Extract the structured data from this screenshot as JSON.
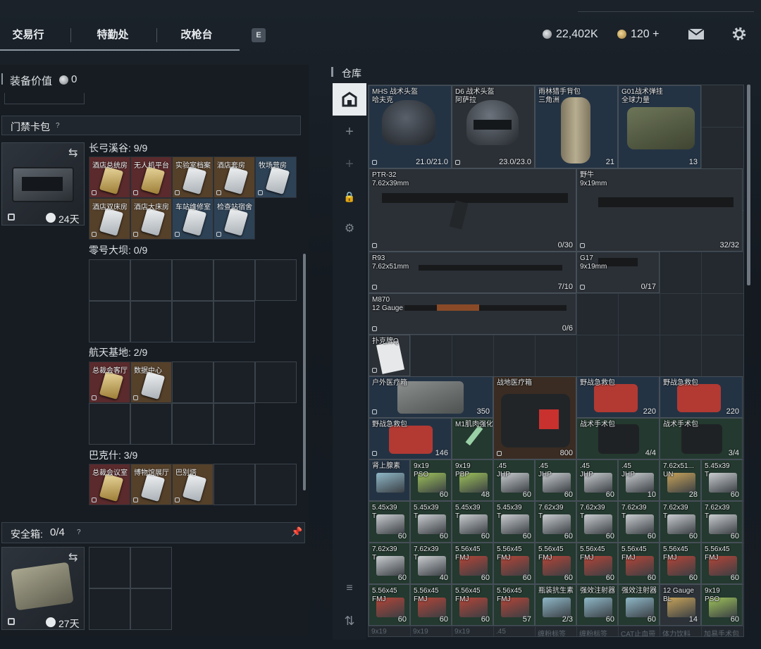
{
  "top_tabs": [
    "交易行",
    "特勤处",
    "改枪台"
  ],
  "hotkey": "E",
  "currency": {
    "silver": "22,402K",
    "gold": "120 +"
  },
  "equipment_value": {
    "label": "装备价值",
    "value": "0"
  },
  "keycard_case": {
    "title": "门禁卡包",
    "help": "?",
    "duration": "24天",
    "maps": [
      {
        "name": "长弓溪谷: 9/9",
        "cards": [
          {
            "label": "酒店总统房",
            "color": "red"
          },
          {
            "label": "无人机平台",
            "color": "red"
          },
          {
            "label": "实验室档案",
            "color": "brown"
          },
          {
            "label": "酒店套房",
            "color": "brown"
          },
          {
            "label": "牧场营房",
            "color": "blue"
          },
          {
            "label": "酒店双床房",
            "color": "brown"
          },
          {
            "label": "酒店大床房",
            "color": "brown"
          },
          {
            "label": "车站维修室",
            "color": "blue"
          },
          {
            "label": "检查站宿舍",
            "color": "blue"
          }
        ]
      },
      {
        "name": "零号大坝: 0/9",
        "cards": []
      },
      {
        "name": "航天基地: 2/9",
        "cards": [
          {
            "label": "总裁会客厅",
            "color": "red"
          },
          {
            "label": "数据中心",
            "color": "brown"
          }
        ]
      },
      {
        "name": "巴克什: 3/9",
        "cards": [
          {
            "label": "总裁会议室",
            "color": "red"
          },
          {
            "label": "博物馆展厅",
            "color": "brown"
          },
          {
            "label": "巴别塔",
            "color": "brown"
          }
        ]
      }
    ]
  },
  "safe_box": {
    "title": "安全箱:",
    "capacity": "0/4",
    "help": "?",
    "duration": "27天"
  },
  "warehouse": {
    "title": "仓库",
    "items": [
      {
        "name": "MHS 战术头盔\n哈夫克",
        "count": "21.0/21.0",
        "bg": "blue"
      },
      {
        "name": "D6 战术头盔\n阿萨拉",
        "count": "23.0/23.0",
        "bg": "dark"
      },
      {
        "name": "雨林猎手背包\n三角洲",
        "count": "21",
        "bg": "blue"
      },
      {
        "name": "G01战术弹挂\n全球力量",
        "count": "13",
        "bg": "blue"
      },
      {
        "name": "PTR-32\n7.62x39mm",
        "count": "0/30",
        "bg": "dark"
      },
      {
        "name": "野牛\n9x19mm",
        "count": "32/32",
        "bg": "dark"
      },
      {
        "name": "R93\n7.62x51mm",
        "count": "7/10",
        "bg": "dark"
      },
      {
        "name": "G17\n9x19mm",
        "count": "0/17",
        "bg": "dark"
      },
      {
        "name": "M870\n12 Gauge",
        "count": "0/6",
        "bg": "dark"
      },
      {
        "name": "扑克牌Q",
        "count": "",
        "bg": "dark"
      },
      {
        "name": "户外医疗箱",
        "count": "350",
        "bg": "blue"
      },
      {
        "name": "战地医疗箱",
        "count": "800",
        "bg": "brown"
      },
      {
        "name": "野战急救包",
        "count": "220",
        "bg": "blue"
      },
      {
        "name": "野战急救包",
        "count": "220",
        "bg": "blue"
      },
      {
        "name": "野战急救包",
        "count": "146",
        "bg": "blue"
      },
      {
        "name": "M1肌肉强化",
        "count": "",
        "bg": "green"
      },
      {
        "name": "战术手术包",
        "count": "4/4",
        "bg": "green"
      },
      {
        "name": "战术手术包",
        "count": "3/4",
        "bg": "green"
      },
      {
        "name": "肾上腺素",
        "count": "",
        "bg": "blue"
      },
      {
        "name": "9x19\nPSO",
        "count": "60",
        "bg": "green"
      },
      {
        "name": "9x19\nPBP",
        "count": "48",
        "bg": "green"
      },
      {
        "name": ".45\nJHP",
        "count": "60",
        "bg": "green"
      },
      {
        "name": ".45\nJHP",
        "count": "60",
        "bg": "green"
      },
      {
        "name": ".45\nJHP",
        "count": "60",
        "bg": "green"
      },
      {
        "name": ".45\nJHP",
        "count": "10",
        "bg": "green"
      },
      {
        "name": "7.62x51...\nUN",
        "count": "28",
        "bg": "green"
      },
      {
        "name": "5.45x39\nT",
        "count": "60",
        "bg": "green"
      },
      {
        "name": "5.45x39\nT",
        "count": "60",
        "bg": "green"
      },
      {
        "name": "5.45x39\nT",
        "count": "60",
        "bg": "green"
      },
      {
        "name": "5.45x39\nT",
        "count": "60",
        "bg": "green"
      },
      {
        "name": "5.45x39\nT",
        "count": "60",
        "bg": "green"
      },
      {
        "name": "7.62x39\nT",
        "count": "60",
        "bg": "green"
      },
      {
        "name": "7.62x39\nT",
        "count": "60",
        "bg": "green"
      },
      {
        "name": "7.62x39\nT",
        "count": "60",
        "bg": "green"
      },
      {
        "name": "7.62x39\nT",
        "count": "60",
        "bg": "green"
      },
      {
        "name": "7.62x39\nT",
        "count": "60",
        "bg": "green"
      },
      {
        "name": "7.62x39\nT",
        "count": "60",
        "bg": "green"
      },
      {
        "name": "7.62x39\nT",
        "count": "40",
        "bg": "green"
      },
      {
        "name": "5.56x45\nFMJ",
        "count": "60",
        "bg": "green"
      },
      {
        "name": "5.56x45\nFMJ",
        "count": "60",
        "bg": "green"
      },
      {
        "name": "5.56x45\nFMJ",
        "count": "60",
        "bg": "green"
      },
      {
        "name": "5.56x45\nFMJ",
        "count": "60",
        "bg": "green"
      },
      {
        "name": "5.56x45\nFMJ",
        "count": "60",
        "bg": "green"
      },
      {
        "name": "5.56x45\nFMJ",
        "count": "60",
        "bg": "green"
      },
      {
        "name": "5.56x45\nFMJ",
        "count": "60",
        "bg": "green"
      },
      {
        "name": "5.56x45\nFMJ",
        "count": "60",
        "bg": "green"
      },
      {
        "name": "5.56x45\nFMJ",
        "count": "60",
        "bg": "green"
      },
      {
        "name": "5.56x45\nFMJ",
        "count": "60",
        "bg": "green"
      },
      {
        "name": "5.56x45\nFMJ",
        "count": "57",
        "bg": "green"
      },
      {
        "name": "瓶装抗生素",
        "count": "2/3",
        "bg": "green"
      },
      {
        "name": "强效注射器",
        "count": "60",
        "bg": "green"
      },
      {
        "name": "强效注射器",
        "count": "60",
        "bg": "green"
      },
      {
        "name": "12 Gauge\nBL",
        "count": "14",
        "bg": "grey"
      },
      {
        "name": "9x19\nPSO",
        "count": "60",
        "bg": "green"
      }
    ],
    "bottom_peek": [
      "9x19",
      "9x19",
      "9x19",
      ".45",
      "缠粉标签",
      "缠粉标签",
      "CAT止血带",
      "体力饮料",
      "加易手术包"
    ]
  },
  "colors": {
    "card_red": "#5a2a2c",
    "card_brown": "#55402a",
    "card_blue": "#2e4256"
  }
}
